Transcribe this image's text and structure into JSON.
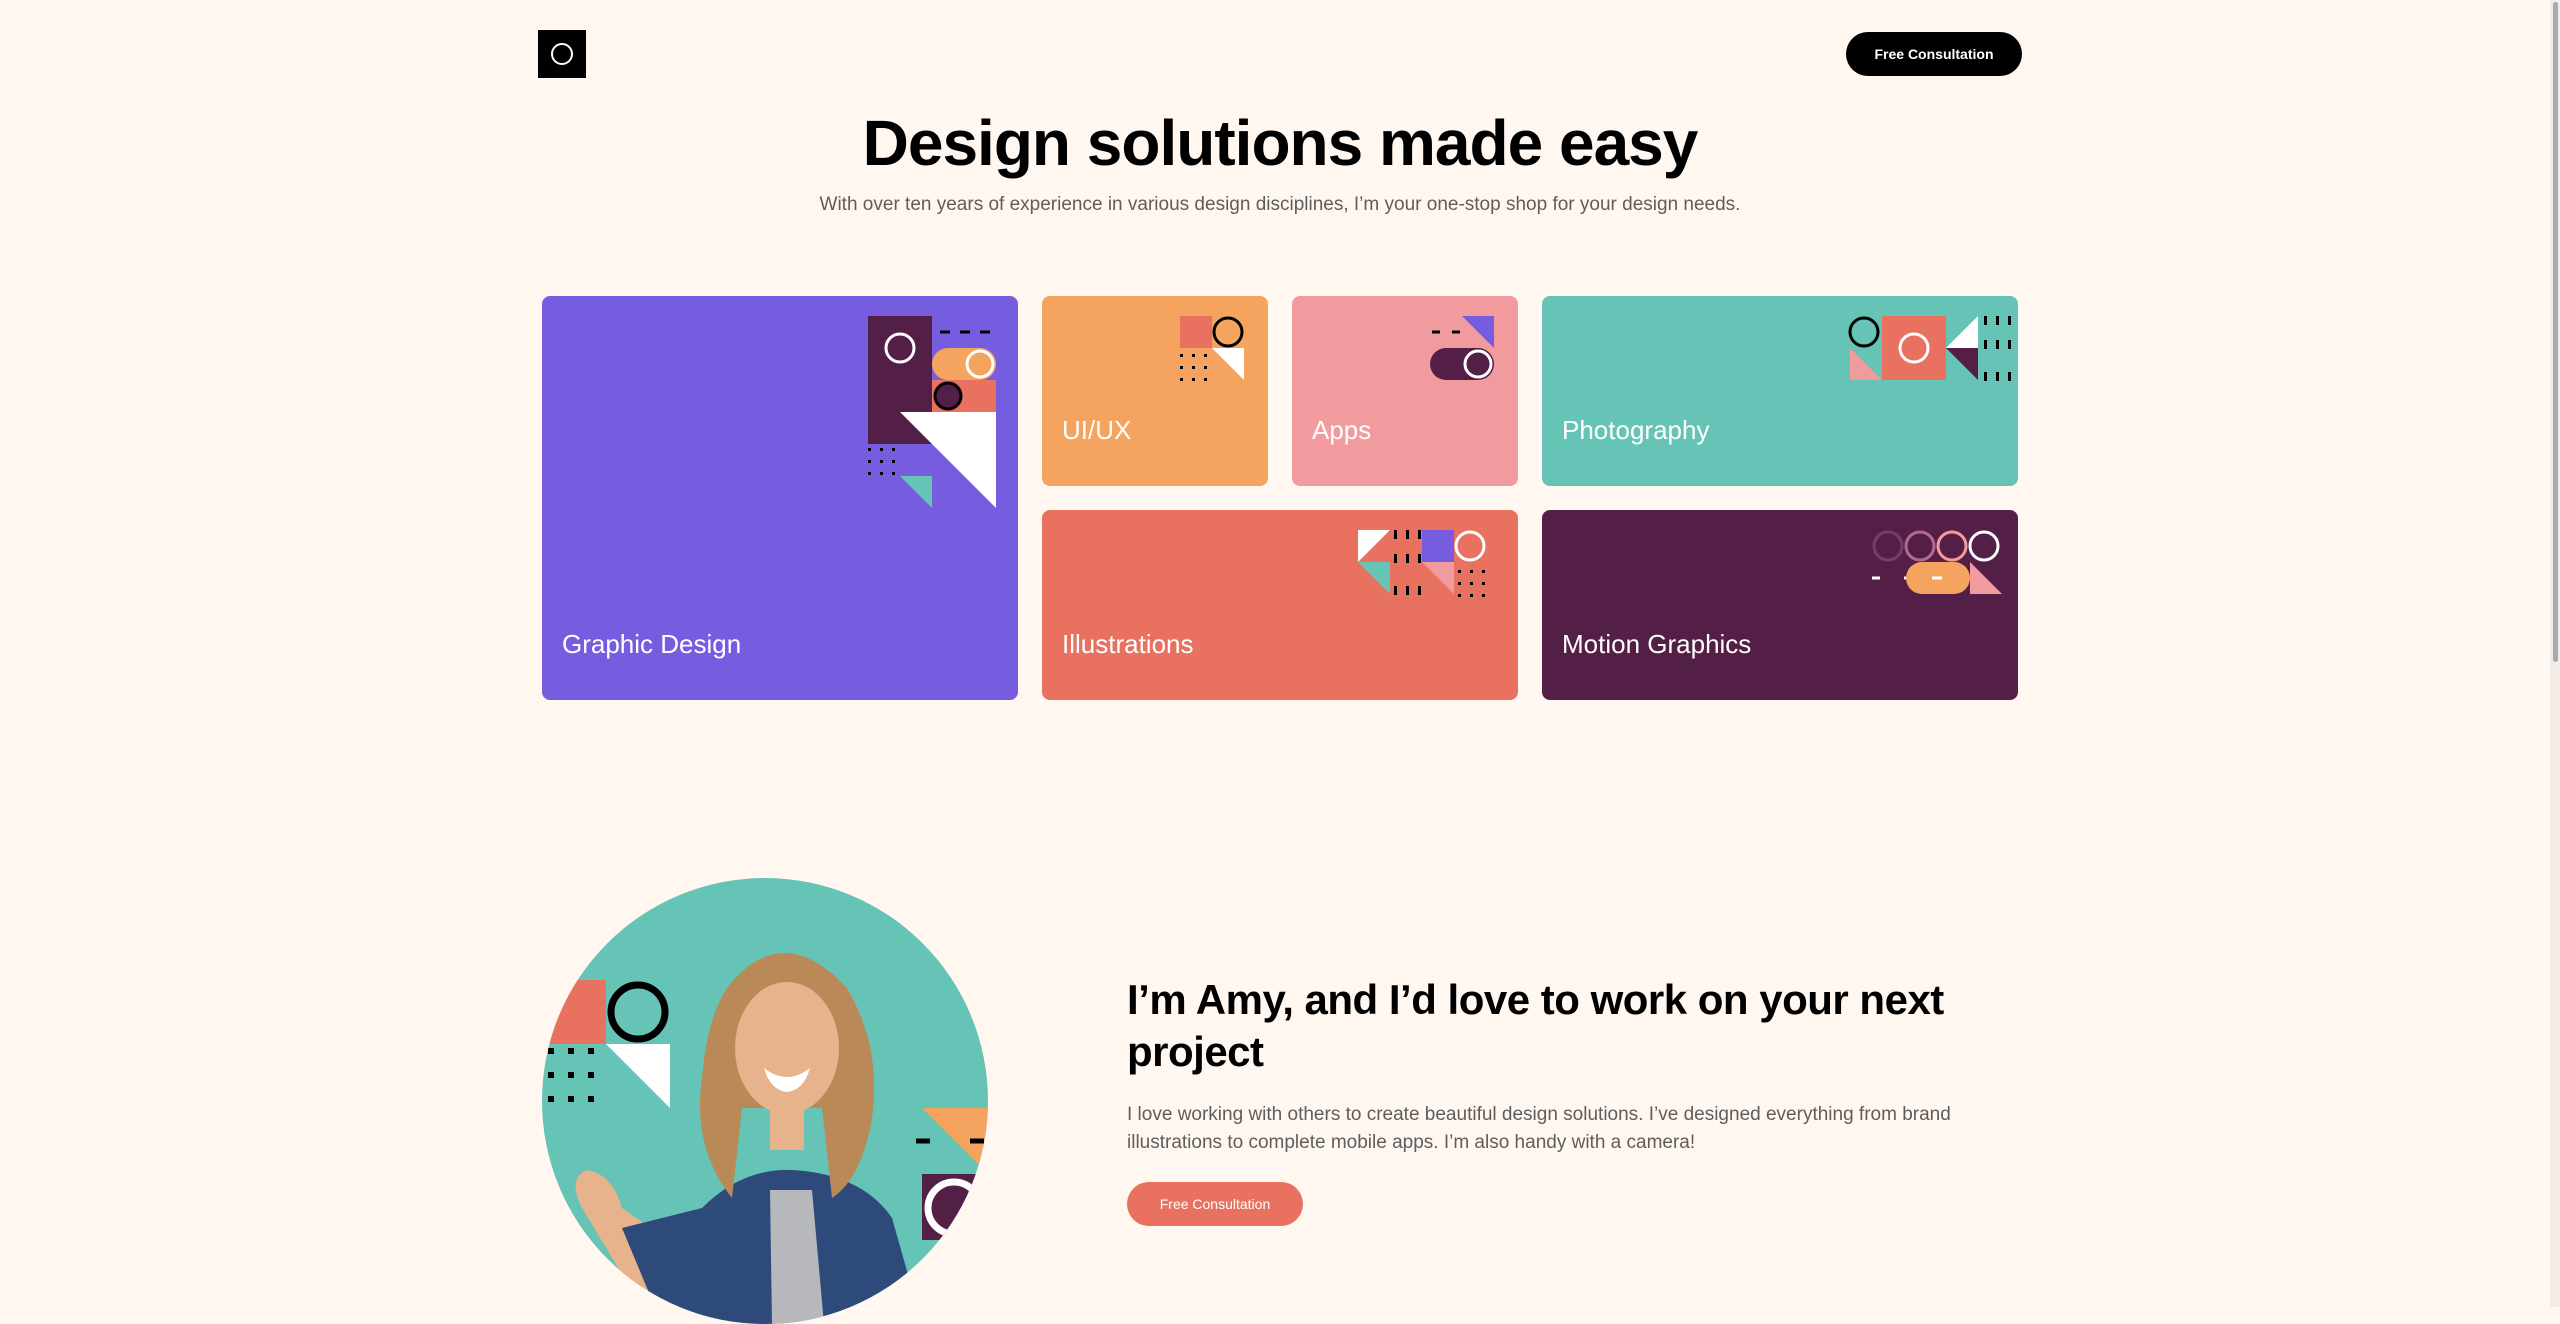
{
  "header": {
    "cta_label": "Free Consultation"
  },
  "hero": {
    "title": "Design solutions made easy",
    "subtitle": "With over ten years of experience in various design disciplines, I’m your one-stop shop for your design needs."
  },
  "services": [
    {
      "label": "Graphic Design",
      "color": "#765DE0"
    },
    {
      "label": "UI/UX",
      "color": "#F4A45F"
    },
    {
      "label": "Apps",
      "color": "#F29B9E"
    },
    {
      "label": "Photography",
      "color": "#65C4B6"
    },
    {
      "label": "Illustrations",
      "color": "#E8725F"
    },
    {
      "label": "Motion Graphics",
      "color": "#541F47"
    }
  ],
  "about": {
    "title": "I’m Amy, and I’d love to work on your next project",
    "text": "I love working with others to create beautiful design solutions. I’ve designed everything from brand illustrations to complete mobile apps. I’m also handy with a camera!",
    "cta_label": "Free Consultation"
  },
  "colors": {
    "background": "#FFF7F0",
    "dark": "#000000",
    "accent": "#E8725F",
    "plum": "#541F47",
    "teal": "#65C4B6",
    "orange": "#F4A45F",
    "purple": "#765DE0",
    "pink": "#F29B9E"
  },
  "icons": {
    "logo": "ring-logo-icon"
  }
}
